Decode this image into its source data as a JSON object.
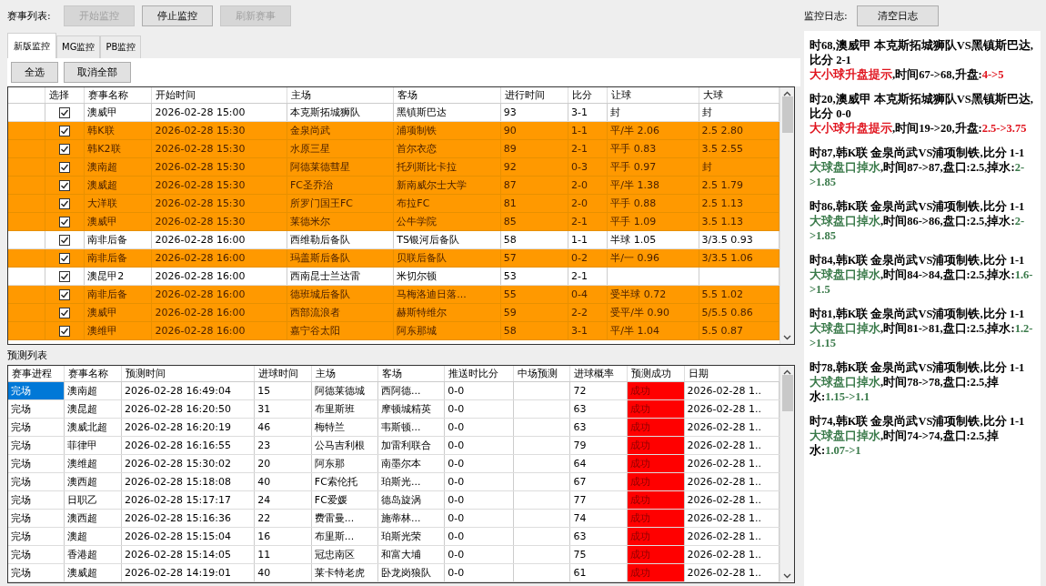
{
  "toolbar": {
    "label": "赛事列表:",
    "buttons": [
      {
        "label": "开始监控",
        "disabled": true
      },
      {
        "label": "停止监控",
        "disabled": false
      },
      {
        "label": "刷新赛事",
        "disabled": true
      }
    ]
  },
  "tabs": [
    {
      "label": "新版监控",
      "selected": true
    },
    {
      "label": "MG监控",
      "selected": false
    },
    {
      "label": "PB监控",
      "selected": false
    }
  ],
  "selection_buttons": [
    "全选",
    "取消全部"
  ],
  "match_table": {
    "columns": [
      "选择",
      "赛事名称",
      "开始时间",
      "主场",
      "客场",
      "进行时间",
      "比分",
      "让球",
      "大球"
    ],
    "rows": [
      {
        "highlighted": false,
        "checked": true,
        "league": "澳威甲",
        "start_time": "2026-02-28 15:00",
        "home": "本克斯拓城狮队",
        "away": "黑镇斯巴达",
        "elapsed": "93",
        "score": "3-1",
        "handicap": "封",
        "over": "封"
      },
      {
        "highlighted": true,
        "checked": true,
        "league": "韩K联",
        "start_time": "2026-02-28 15:30",
        "home": "金泉尚武",
        "away": "浦项制铁",
        "elapsed": "90",
        "score": "1-1",
        "handicap": "平/半 2.06",
        "over": "2.5 2.80"
      },
      {
        "highlighted": true,
        "checked": true,
        "league": "韩K2联",
        "start_time": "2026-02-28 15:30",
        "home": "水原三星",
        "away": "首尔衣恋",
        "elapsed": "89",
        "score": "2-1",
        "handicap": "平手 0.83",
        "over": "3.5 2.55"
      },
      {
        "highlighted": true,
        "checked": true,
        "league": "澳南超",
        "start_time": "2026-02-28 15:30",
        "home": "阿德莱德彗星",
        "away": "托列斯比卡拉",
        "elapsed": "92",
        "score": "0-3",
        "handicap": "平手 0.97",
        "over": "封"
      },
      {
        "highlighted": true,
        "checked": true,
        "league": "澳威超",
        "start_time": "2026-02-28 15:30",
        "home": "FC圣乔治",
        "away": "新南威尔士大学",
        "elapsed": "87",
        "score": "2-0",
        "handicap": "平/半 1.38",
        "over": "2.5 1.79"
      },
      {
        "highlighted": true,
        "checked": true,
        "league": "大洋联",
        "start_time": "2026-02-28 15:30",
        "home": "所罗门国王FC",
        "away": "布拉FC",
        "elapsed": "81",
        "score": "2-0",
        "handicap": "平手 0.88",
        "over": "2.5 1.13"
      },
      {
        "highlighted": true,
        "checked": true,
        "league": "澳威甲",
        "start_time": "2026-02-28 15:30",
        "home": "莱德米尔",
        "away": "公牛学院",
        "elapsed": "85",
        "score": "2-1",
        "handicap": "平手 1.09",
        "over": "3.5 1.13"
      },
      {
        "highlighted": false,
        "checked": true,
        "league": "南非后备",
        "start_time": "2026-02-28 16:00",
        "home": "西维勒后备队",
        "away": "TS银河后备队",
        "elapsed": "58",
        "score": "1-1",
        "handicap": "半球 1.05",
        "over": "3/3.5 0.93"
      },
      {
        "highlighted": true,
        "checked": true,
        "league": "南非后备",
        "start_time": "2026-02-28 16:00",
        "home": "玛盖斯后备队",
        "away": "贝联后备队",
        "elapsed": "57",
        "score": "0-2",
        "handicap": "半/一 0.96",
        "over": "3/3.5 1.06"
      },
      {
        "highlighted": false,
        "checked": true,
        "league": "澳昆甲2",
        "start_time": "2026-02-28 16:00",
        "home": "西南昆士兰达雷",
        "away": "米切尔顿",
        "elapsed": "53",
        "score": "2-1"
      },
      {
        "highlighted": true,
        "checked": true,
        "league": "南非后备",
        "start_time": "2026-02-28 16:00",
        "home": "德班城后备队",
        "away": "马梅洛迪日落...",
        "elapsed": "55",
        "score": "0-4",
        "handicap": "受半球 0.72",
        "over": "5.5 1.02"
      },
      {
        "highlighted": true,
        "checked": true,
        "league": "澳威甲",
        "start_time": "2026-02-28 16:00",
        "home": "西部流浪者",
        "away": "赫斯特维尔",
        "elapsed": "59",
        "score": "2-2",
        "handicap": "受平/半 0.90",
        "over": "5/5.5 0.86"
      },
      {
        "highlighted": true,
        "checked": true,
        "league": "澳维甲",
        "start_time": "2026-02-28 16:00",
        "home": "嘉宁谷太阳",
        "away": "阿东那城",
        "elapsed": "58",
        "score": "3-1",
        "handicap": "平/半 1.04",
        "over": "5.5 0.87"
      }
    ]
  },
  "prediction_label": "预测列表",
  "prediction_table": {
    "columns": [
      "赛事进程",
      "赛事名称",
      "预测时间",
      "进球时间",
      "主场",
      "客场",
      "推送时比分",
      "中场预测",
      "进球概率",
      "预测成功",
      "日期"
    ],
    "rows": [
      {
        "selected": true,
        "status": "完场",
        "league": "澳南超",
        "predict_time": "2026-02-28 16:49:04",
        "goal_time": "15",
        "home": "阿德莱德城",
        "away": "西阿德...",
        "push_score": "0-0",
        "probability": "72",
        "result": "成功",
        "success": true,
        "date": "2026-02-28 1.."
      },
      {
        "selected": false,
        "status": "完场",
        "league": "澳昆超",
        "predict_time": "2026-02-28 16:20:50",
        "goal_time": "31",
        "home": "布里斯班",
        "away": "摩顿城精英",
        "push_score": "0-0",
        "probability": "63",
        "result": "成功",
        "success": true,
        "date": "2026-02-28 1.."
      },
      {
        "selected": false,
        "status": "完场",
        "league": "澳威北超",
        "predict_time": "2026-02-28 16:20:19",
        "goal_time": "46",
        "home": "梅特兰",
        "away": "韦斯顿...",
        "push_score": "0-0",
        "probability": "63",
        "result": "成功",
        "success": true,
        "date": "2026-02-28 1.."
      },
      {
        "selected": false,
        "status": "完场",
        "league": "菲律甲",
        "predict_time": "2026-02-28 16:16:55",
        "goal_time": "23",
        "home": "公马吉利根",
        "away": "加雷利联合",
        "push_score": "0-0",
        "probability": "79",
        "result": "成功",
        "success": true,
        "date": "2026-02-28 1.."
      },
      {
        "selected": false,
        "status": "完场",
        "league": "澳维超",
        "predict_time": "2026-02-28 15:30:02",
        "goal_time": "20",
        "home": "阿东那",
        "away": "南墨尔本",
        "push_score": "0-0",
        "probability": "64",
        "result": "成功",
        "success": true,
        "date": "2026-02-28 1.."
      },
      {
        "selected": false,
        "status": "完场",
        "league": "澳西超",
        "predict_time": "2026-02-28 15:18:08",
        "goal_time": "40",
        "home": "FC索伦托",
        "away": "珀斯光...",
        "push_score": "0-0",
        "probability": "67",
        "result": "成功",
        "success": true,
        "date": "2026-02-28 1.."
      },
      {
        "selected": false,
        "status": "完场",
        "league": "日职乙",
        "predict_time": "2026-02-28 15:17:17",
        "goal_time": "24",
        "home": "FC爱媛",
        "away": "德岛旋涡",
        "push_score": "0-0",
        "probability": "77",
        "result": "成功",
        "success": true,
        "date": "2026-02-28 1.."
      },
      {
        "selected": false,
        "status": "完场",
        "league": "澳西超",
        "predict_time": "2026-02-28 15:16:36",
        "goal_time": "22",
        "home": "费雷曼...",
        "away": "施蒂林...",
        "push_score": "0-0",
        "probability": "74",
        "result": "成功",
        "success": true,
        "date": "2026-02-28 1.."
      },
      {
        "selected": false,
        "status": "完场",
        "league": "澳超",
        "predict_time": "2026-02-28 15:15:04",
        "goal_time": "16",
        "home": "布里斯...",
        "away": "珀斯光荣",
        "push_score": "0-0",
        "probability": "63",
        "result": "成功",
        "success": true,
        "date": "2026-02-28 1.."
      },
      {
        "selected": false,
        "status": "完场",
        "league": "香港超",
        "predict_time": "2026-02-28 15:14:05",
        "goal_time": "11",
        "home": "冠忠南区",
        "away": "和富大埔",
        "push_score": "0-0",
        "probability": "75",
        "result": "成功",
        "success": true,
        "date": "2026-02-28 1.."
      },
      {
        "selected": false,
        "status": "完场",
        "league": "澳威超",
        "predict_time": "2026-02-28 14:19:01",
        "goal_time": "40",
        "home": "莱卡特老虎",
        "away": "卧龙岗狼队",
        "push_score": "0-0",
        "probability": "61",
        "result": "成功",
        "success": true,
        "date": "2026-02-28 1.."
      }
    ]
  },
  "log": {
    "label": "监控日志:",
    "clear_button": "清空日志",
    "entries": [
      {
        "kind": "rise",
        "header": "时68,澳威甲  本克斯拓城狮队VS黑镇斯巴达,比分  2-1",
        "alert": "大小球升盘提示",
        "detail": ",时间67->68,升盘:",
        "change": "4->5"
      },
      {
        "kind": "rise",
        "header": "时20,澳威甲  本克斯拓城狮队VS黑镇斯巴达,比分  0-0",
        "alert": "大小球升盘提示",
        "detail": ",时间19->20,升盘:",
        "change": "2.5->3.75"
      },
      {
        "kind": "drop",
        "header": "时87,韩K联  金泉尚武VS浦项制铁,比分  1-1",
        "alert": "大球盘口掉水",
        "detail": ",时间87->87,盘口:2.5,掉水:",
        "change": "2->1.85"
      },
      {
        "kind": "drop",
        "header": "时86,韩K联  金泉尚武VS浦项制铁,比分  1-1",
        "alert": "大球盘口掉水",
        "detail": ",时间86->86,盘口:2.5,掉水:",
        "change": "2->1.85"
      },
      {
        "kind": "drop",
        "header": "时84,韩K联  金泉尚武VS浦项制铁,比分  1-1",
        "alert": "大球盘口掉水",
        "detail": ",时间84->84,盘口:2.5,掉水:",
        "change": "1.6->1.5"
      },
      {
        "kind": "drop",
        "header": "时81,韩K联  金泉尚武VS浦项制铁,比分  1-1",
        "alert": "大球盘口掉水",
        "detail": ",时间81->81,盘口:2.5,掉水:",
        "change": "1.2->1.15"
      },
      {
        "kind": "drop",
        "header": "时78,韩K联  金泉尚武VS浦项制铁,比分  1-1",
        "alert": "大球盘口掉水",
        "detail": ",时间78->78,盘口:2.5,掉水:",
        "change": "1.15->1.1"
      },
      {
        "kind": "drop",
        "header": "时74,韩K联  金泉尚武VS浦项制铁,比分  1-1",
        "alert": "大球盘口掉水",
        "detail": ",时间74->74,盘口:2.5,掉水:",
        "change": "1.07->1"
      }
    ]
  }
}
